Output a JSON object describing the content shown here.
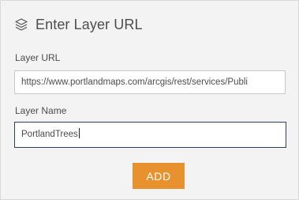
{
  "header": {
    "icon": "layers-icon",
    "title": "Enter Layer URL"
  },
  "layer_url": {
    "label": "Layer URL",
    "value": "https://www.portlandmaps.com/arcgis/rest/services/Publi"
  },
  "layer_name": {
    "label": "Layer Name",
    "value": "PortlandTrees"
  },
  "actions": {
    "add_label": "ADD"
  },
  "colors": {
    "accent": "#e8912f",
    "focus_border": "#2f3f5a",
    "panel_bg": "#f3f3f3"
  }
}
